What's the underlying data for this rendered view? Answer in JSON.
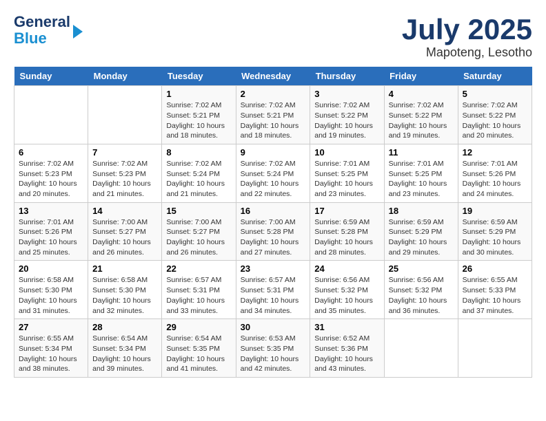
{
  "logo": {
    "line1": "General",
    "line2": "Blue",
    "arrow": true
  },
  "title": {
    "month_year": "July 2025",
    "location": "Mapoteng, Lesotho"
  },
  "weekdays": [
    "Sunday",
    "Monday",
    "Tuesday",
    "Wednesday",
    "Thursday",
    "Friday",
    "Saturday"
  ],
  "weeks": [
    [
      {
        "day": "",
        "sunrise": "",
        "sunset": "",
        "daylight": ""
      },
      {
        "day": "",
        "sunrise": "",
        "sunset": "",
        "daylight": ""
      },
      {
        "day": "1",
        "sunrise": "Sunrise: 7:02 AM",
        "sunset": "Sunset: 5:21 PM",
        "daylight": "Daylight: 10 hours and 18 minutes."
      },
      {
        "day": "2",
        "sunrise": "Sunrise: 7:02 AM",
        "sunset": "Sunset: 5:21 PM",
        "daylight": "Daylight: 10 hours and 18 minutes."
      },
      {
        "day": "3",
        "sunrise": "Sunrise: 7:02 AM",
        "sunset": "Sunset: 5:22 PM",
        "daylight": "Daylight: 10 hours and 19 minutes."
      },
      {
        "day": "4",
        "sunrise": "Sunrise: 7:02 AM",
        "sunset": "Sunset: 5:22 PM",
        "daylight": "Daylight: 10 hours and 19 minutes."
      },
      {
        "day": "5",
        "sunrise": "Sunrise: 7:02 AM",
        "sunset": "Sunset: 5:22 PM",
        "daylight": "Daylight: 10 hours and 20 minutes."
      }
    ],
    [
      {
        "day": "6",
        "sunrise": "Sunrise: 7:02 AM",
        "sunset": "Sunset: 5:23 PM",
        "daylight": "Daylight: 10 hours and 20 minutes."
      },
      {
        "day": "7",
        "sunrise": "Sunrise: 7:02 AM",
        "sunset": "Sunset: 5:23 PM",
        "daylight": "Daylight: 10 hours and 21 minutes."
      },
      {
        "day": "8",
        "sunrise": "Sunrise: 7:02 AM",
        "sunset": "Sunset: 5:24 PM",
        "daylight": "Daylight: 10 hours and 21 minutes."
      },
      {
        "day": "9",
        "sunrise": "Sunrise: 7:02 AM",
        "sunset": "Sunset: 5:24 PM",
        "daylight": "Daylight: 10 hours and 22 minutes."
      },
      {
        "day": "10",
        "sunrise": "Sunrise: 7:01 AM",
        "sunset": "Sunset: 5:25 PM",
        "daylight": "Daylight: 10 hours and 23 minutes."
      },
      {
        "day": "11",
        "sunrise": "Sunrise: 7:01 AM",
        "sunset": "Sunset: 5:25 PM",
        "daylight": "Daylight: 10 hours and 23 minutes."
      },
      {
        "day": "12",
        "sunrise": "Sunrise: 7:01 AM",
        "sunset": "Sunset: 5:26 PM",
        "daylight": "Daylight: 10 hours and 24 minutes."
      }
    ],
    [
      {
        "day": "13",
        "sunrise": "Sunrise: 7:01 AM",
        "sunset": "Sunset: 5:26 PM",
        "daylight": "Daylight: 10 hours and 25 minutes."
      },
      {
        "day": "14",
        "sunrise": "Sunrise: 7:00 AM",
        "sunset": "Sunset: 5:27 PM",
        "daylight": "Daylight: 10 hours and 26 minutes."
      },
      {
        "day": "15",
        "sunrise": "Sunrise: 7:00 AM",
        "sunset": "Sunset: 5:27 PM",
        "daylight": "Daylight: 10 hours and 26 minutes."
      },
      {
        "day": "16",
        "sunrise": "Sunrise: 7:00 AM",
        "sunset": "Sunset: 5:28 PM",
        "daylight": "Daylight: 10 hours and 27 minutes."
      },
      {
        "day": "17",
        "sunrise": "Sunrise: 6:59 AM",
        "sunset": "Sunset: 5:28 PM",
        "daylight": "Daylight: 10 hours and 28 minutes."
      },
      {
        "day": "18",
        "sunrise": "Sunrise: 6:59 AM",
        "sunset": "Sunset: 5:29 PM",
        "daylight": "Daylight: 10 hours and 29 minutes."
      },
      {
        "day": "19",
        "sunrise": "Sunrise: 6:59 AM",
        "sunset": "Sunset: 5:29 PM",
        "daylight": "Daylight: 10 hours and 30 minutes."
      }
    ],
    [
      {
        "day": "20",
        "sunrise": "Sunrise: 6:58 AM",
        "sunset": "Sunset: 5:30 PM",
        "daylight": "Daylight: 10 hours and 31 minutes."
      },
      {
        "day": "21",
        "sunrise": "Sunrise: 6:58 AM",
        "sunset": "Sunset: 5:30 PM",
        "daylight": "Daylight: 10 hours and 32 minutes."
      },
      {
        "day": "22",
        "sunrise": "Sunrise: 6:57 AM",
        "sunset": "Sunset: 5:31 PM",
        "daylight": "Daylight: 10 hours and 33 minutes."
      },
      {
        "day": "23",
        "sunrise": "Sunrise: 6:57 AM",
        "sunset": "Sunset: 5:31 PM",
        "daylight": "Daylight: 10 hours and 34 minutes."
      },
      {
        "day": "24",
        "sunrise": "Sunrise: 6:56 AM",
        "sunset": "Sunset: 5:32 PM",
        "daylight": "Daylight: 10 hours and 35 minutes."
      },
      {
        "day": "25",
        "sunrise": "Sunrise: 6:56 AM",
        "sunset": "Sunset: 5:32 PM",
        "daylight": "Daylight: 10 hours and 36 minutes."
      },
      {
        "day": "26",
        "sunrise": "Sunrise: 6:55 AM",
        "sunset": "Sunset: 5:33 PM",
        "daylight": "Daylight: 10 hours and 37 minutes."
      }
    ],
    [
      {
        "day": "27",
        "sunrise": "Sunrise: 6:55 AM",
        "sunset": "Sunset: 5:34 PM",
        "daylight": "Daylight: 10 hours and 38 minutes."
      },
      {
        "day": "28",
        "sunrise": "Sunrise: 6:54 AM",
        "sunset": "Sunset: 5:34 PM",
        "daylight": "Daylight: 10 hours and 39 minutes."
      },
      {
        "day": "29",
        "sunrise": "Sunrise: 6:54 AM",
        "sunset": "Sunset: 5:35 PM",
        "daylight": "Daylight: 10 hours and 41 minutes."
      },
      {
        "day": "30",
        "sunrise": "Sunrise: 6:53 AM",
        "sunset": "Sunset: 5:35 PM",
        "daylight": "Daylight: 10 hours and 42 minutes."
      },
      {
        "day": "31",
        "sunrise": "Sunrise: 6:52 AM",
        "sunset": "Sunset: 5:36 PM",
        "daylight": "Daylight: 10 hours and 43 minutes."
      },
      {
        "day": "",
        "sunrise": "",
        "sunset": "",
        "daylight": ""
      },
      {
        "day": "",
        "sunrise": "",
        "sunset": "",
        "daylight": ""
      }
    ]
  ]
}
